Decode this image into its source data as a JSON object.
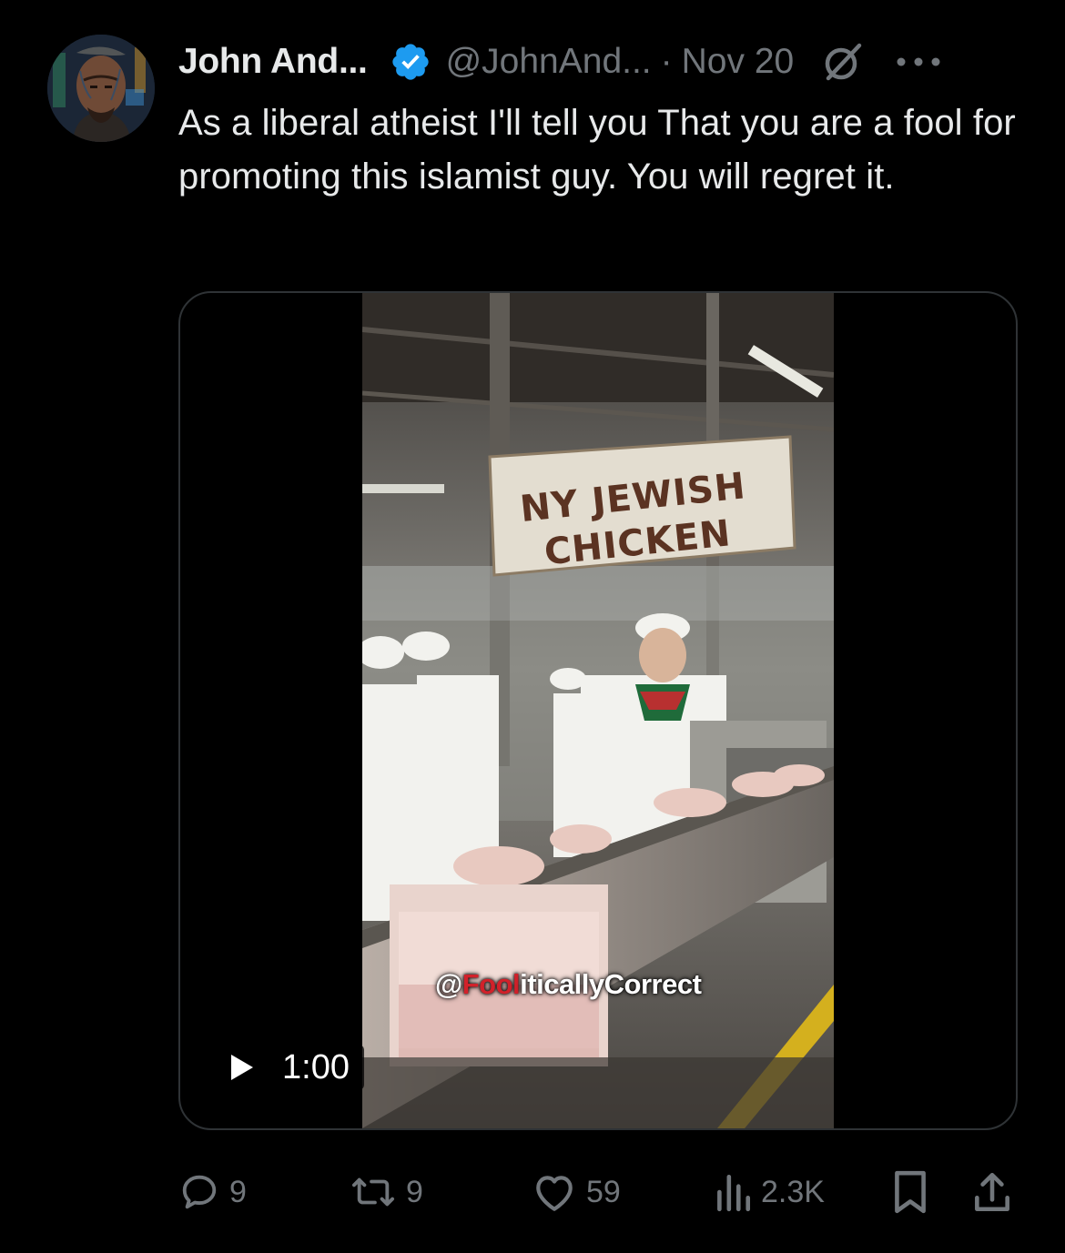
{
  "author": {
    "display_name": "John And...",
    "handle": "@JohnAnd...",
    "separator": "·",
    "date": "Nov 20",
    "verified": true,
    "avatar_icon": "avatar-icon"
  },
  "tweet": {
    "text": "As a liberal atheist I'll tell you That you are a fool for promoting this islamist guy. You will regret it."
  },
  "media": {
    "type": "video",
    "duration": "1:00",
    "sign_line1": "NY JEWISH",
    "sign_line2": "CHICKEN",
    "watermark_at": "@",
    "watermark_red": "Fool",
    "watermark_rest": "iticallyCorrect"
  },
  "actions": {
    "reply_count": "9",
    "repost_count": "9",
    "like_count": "59",
    "views_count": "2.3K"
  },
  "colors": {
    "background": "#000000",
    "text_primary": "#e7e9ea",
    "text_secondary": "#71767b",
    "verified_blue": "#1d9bf0",
    "border": "#2f3336"
  }
}
